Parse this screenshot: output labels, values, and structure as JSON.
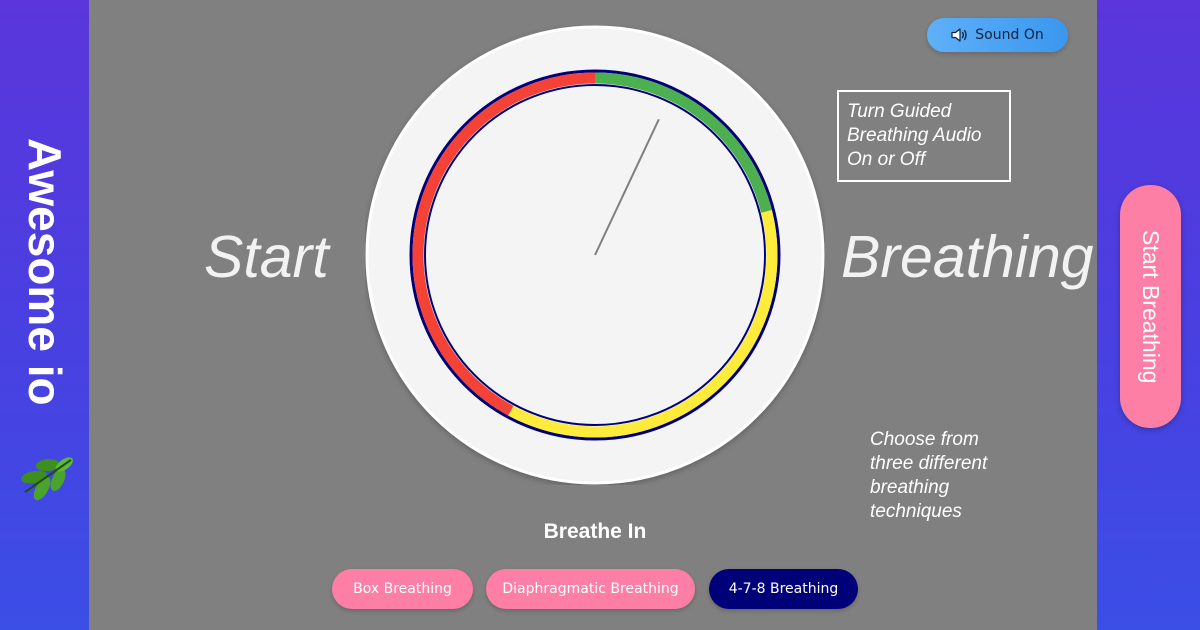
{
  "app": {
    "brand": "Awesome io",
    "brand_icon": "leaf-icon"
  },
  "header": {
    "sound_button_label": "Sound On",
    "sound_icon": "speaker-icon"
  },
  "hero": {
    "left_word": "Start",
    "right_word": "Breathing"
  },
  "tips": {
    "audio": "Turn Guided Breathing Audio On or Off",
    "techniques": "Choose from three different breathing techniques"
  },
  "side_button_label": "Start Breathing",
  "timer": {
    "phase": "Breathe In",
    "segments": [
      {
        "phase": "inhale",
        "fraction": 0.2105,
        "color": "#4caf50"
      },
      {
        "phase": "hold",
        "fraction": 0.3684,
        "color": "#ffeb3b"
      },
      {
        "phase": "exhale",
        "fraction": 0.4211,
        "color": "#f44336"
      }
    ],
    "hand_fraction": 0.07,
    "ring_outline_color": "#000078"
  },
  "techniques": [
    {
      "label": "Box Breathing",
      "active": false
    },
    {
      "label": "Diaphragmatic Breathing",
      "active": false
    },
    {
      "label": "4-7-8 Breathing",
      "active": true
    }
  ],
  "colors": {
    "background": "#808080",
    "side_gradient_top": "#5a36dc",
    "side_gradient_bottom": "#3b4ee6",
    "pink_button": "#fe7fa6",
    "active_button": "#000078",
    "sound_button": "#4aa3f3"
  }
}
